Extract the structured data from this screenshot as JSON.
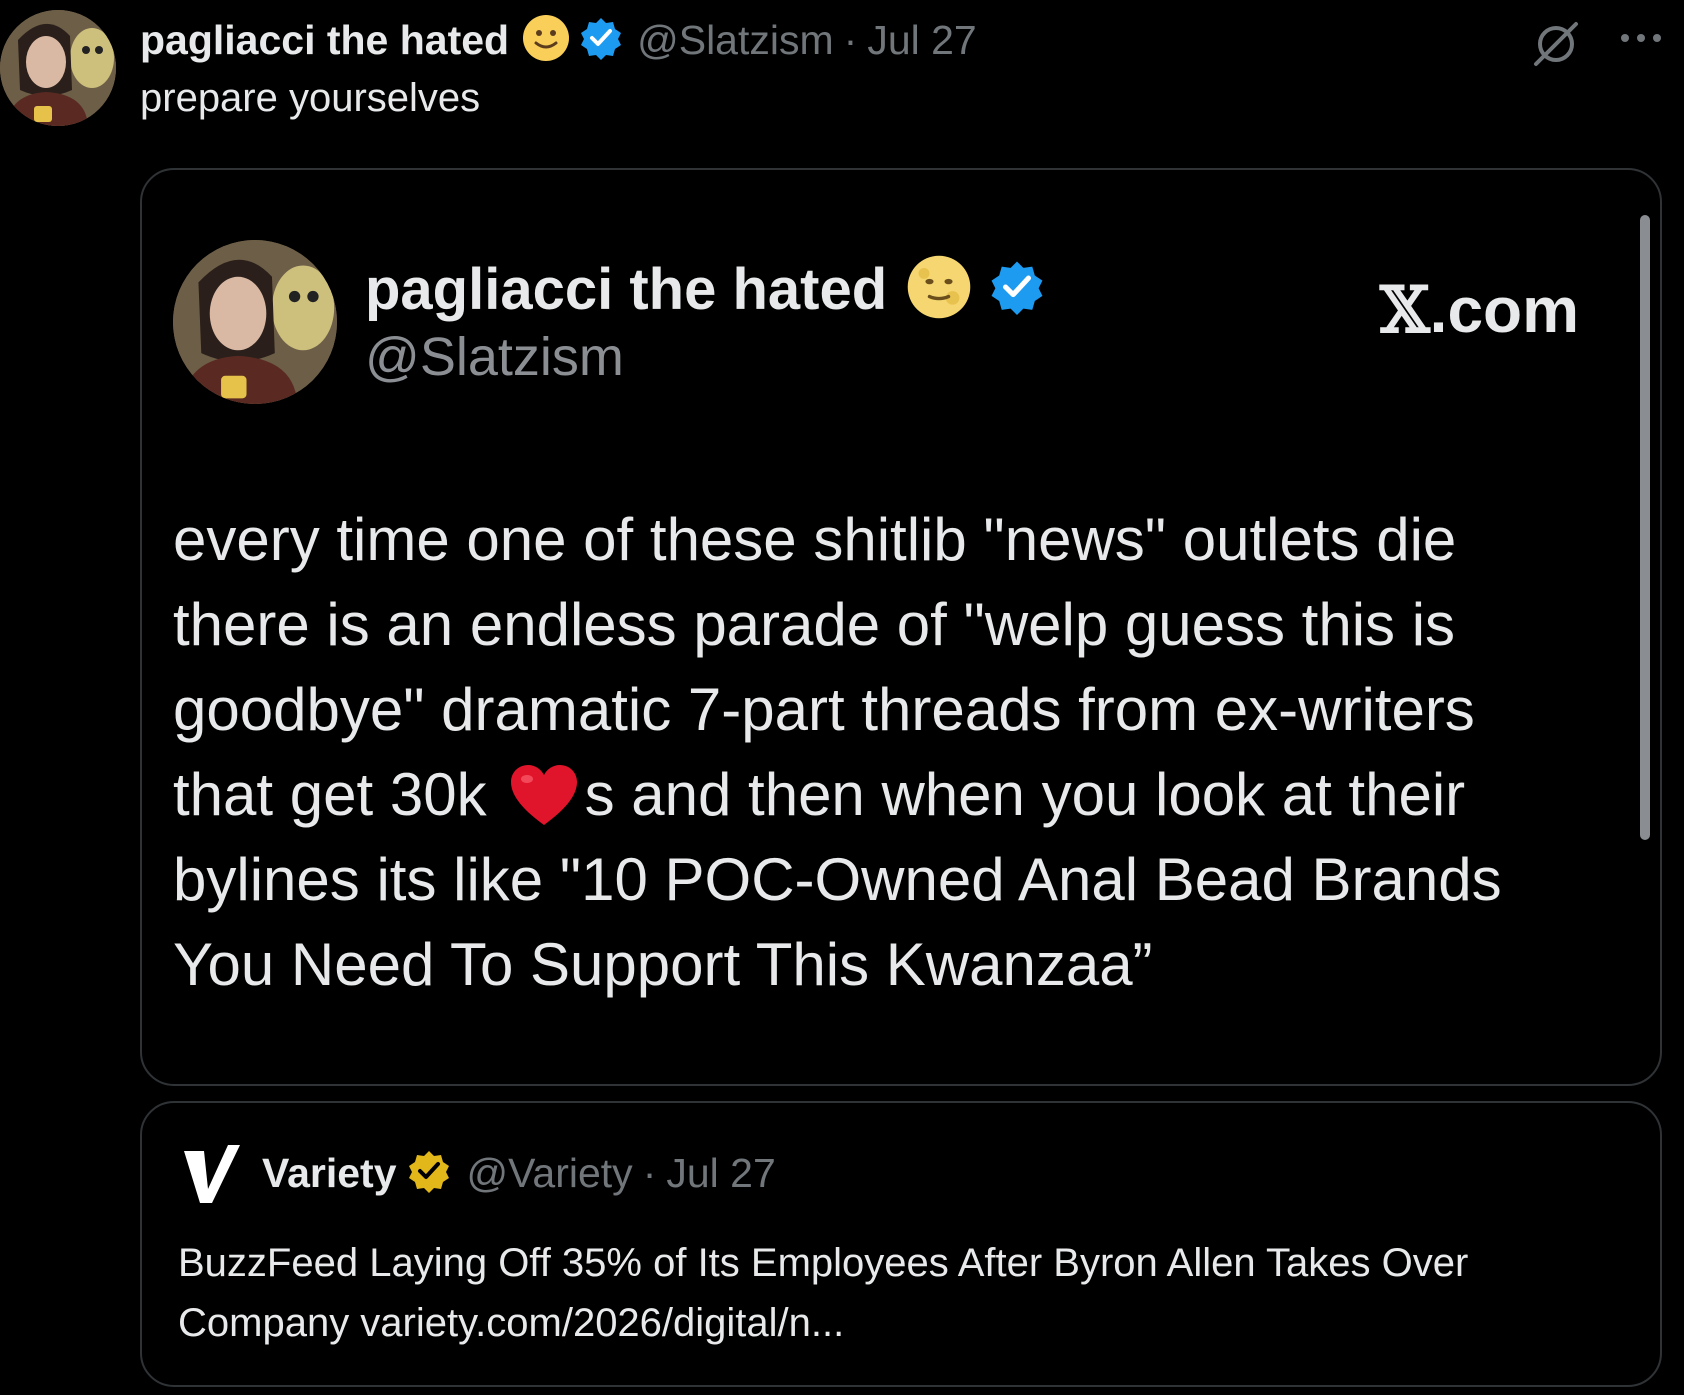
{
  "tweet": {
    "display_name": "pagliacci the hated",
    "name_emoji": "slightly-smiling-face",
    "handle": "@Slatzism",
    "separator": "·",
    "date": "Jul 27",
    "text": "prepare yourselves"
  },
  "quoted_screenshot": {
    "display_name": "pagliacci the hated",
    "name_emoji": "full-moon-face",
    "handle": "@Slatzism",
    "watermark_x": "𝕏",
    "watermark_suffix": ".com",
    "body_lines": [
      "every time one of these shitlib \"news\" outlets die",
      "there is an endless parade of \"welp guess this is",
      "goodbye\" dramatic 7-part threads from ex-writers",
      "bylines its like \"10 POC-Owned Anal Bead Brands",
      "You Need To Support This Kwanzaa”"
    ],
    "line4_before": "that get 30k",
    "line4_after": "s and then when you look at their",
    "heart_icon": "red-heart"
  },
  "quoted_tweet": {
    "display_name": "Variety",
    "handle": "@Variety",
    "separator": "·",
    "date": "Jul 27",
    "text_line1": "BuzzFeed Laying Off 35% of Its Employees After Byron Allen Takes Over",
    "text_line2": "Company variety.com/2026/digital/n..."
  },
  "colors": {
    "background": "#000000",
    "verified_blue": "#1d9bf0",
    "verified_gold": "#e2b719",
    "muted_text": "#71767b",
    "border": "#2f3336"
  }
}
